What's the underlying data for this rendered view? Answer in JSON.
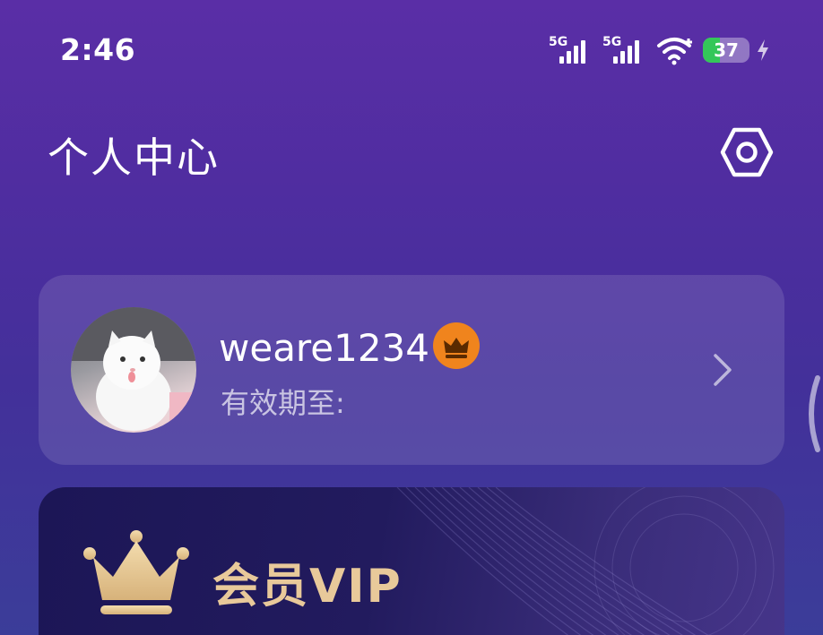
{
  "status_bar": {
    "time": "2:46",
    "sim1_label": "5G",
    "sim2_label": "5G",
    "battery_level": "37",
    "battery_color": "#34c759",
    "icons": [
      "signal-icon",
      "signal-icon",
      "wifi-icon",
      "battery-icon",
      "charging-icon"
    ]
  },
  "header": {
    "title": "个人中心",
    "settings_icon": "settings-icon"
  },
  "profile": {
    "username": "weare1234",
    "expiry_label": "有效期至:",
    "badge_icon": "crown-badge-icon",
    "badge_color": "#f0841d"
  },
  "vip_card": {
    "title": "会员VIP",
    "title_color": "#e8c99a",
    "crown_icon": "crown-icon"
  }
}
